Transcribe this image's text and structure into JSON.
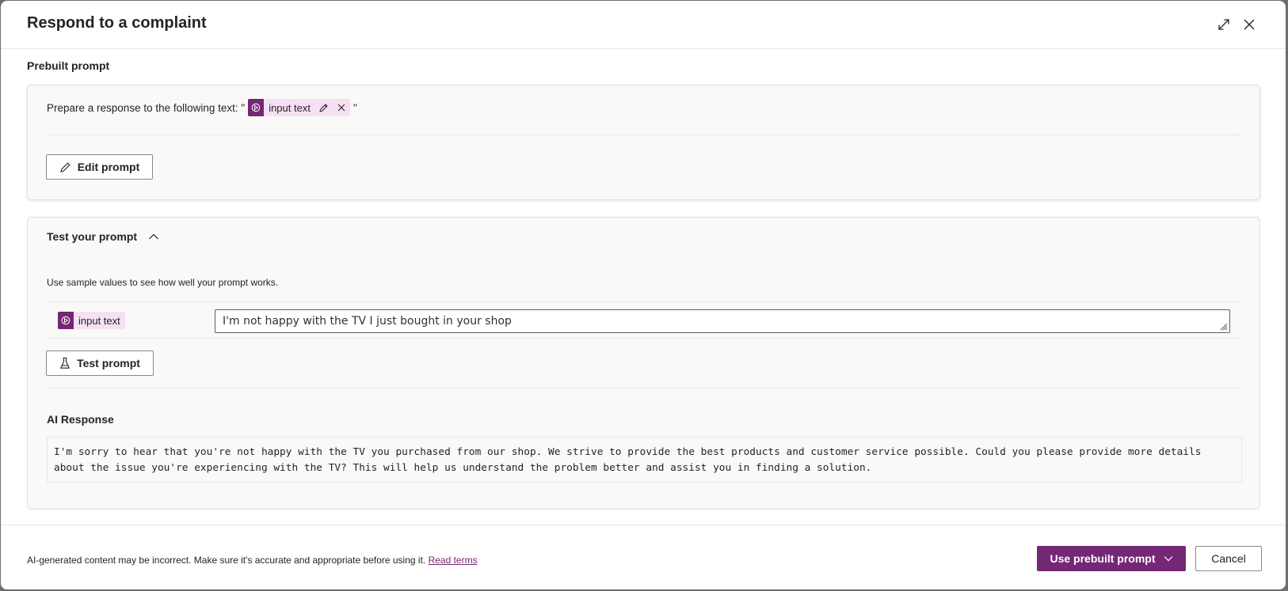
{
  "dialog": {
    "title": "Respond to a complaint",
    "expand_icon": "expand-icon",
    "close_icon": "close-icon"
  },
  "prebuilt": {
    "section_label": "Prebuilt prompt",
    "prompt_prefix": "Prepare a response to the following text: \"",
    "prompt_suffix": "\"",
    "chip": {
      "icon": "ai-input-icon",
      "label": "input text",
      "edit_icon": "pencil-icon",
      "remove_icon": "close-icon"
    },
    "edit_button_label": "Edit prompt"
  },
  "test": {
    "header_label": "Test your prompt",
    "toggle_icon": "chevron-up-icon",
    "helper_text": "Use sample values to see how well your prompt works.",
    "sample": {
      "chip_label": "input text",
      "value": "I'm not happy with the TV I just bought in your shop"
    },
    "test_button_label": "Test prompt",
    "test_button_icon": "flask-icon",
    "ai_response_label": "AI Response",
    "ai_response_text": "I'm sorry to hear that you're not happy with the TV you purchased from our shop. We strive to provide the best products and customer service possible. Could you please provide more details about the issue you're experiencing with the TV? This will help us understand the problem better and assist you in finding a solution."
  },
  "footer": {
    "disclaimer": "AI-generated content may be incorrect. Make sure it's accurate and appropriate before using it. ",
    "read_terms_label": "Read terms",
    "primary_button_label": "Use prebuilt prompt",
    "cancel_button_label": "Cancel"
  },
  "colors": {
    "accent": "#742774",
    "chip_bg": "#f6e1f4",
    "card_bg": "#faf9f8"
  }
}
